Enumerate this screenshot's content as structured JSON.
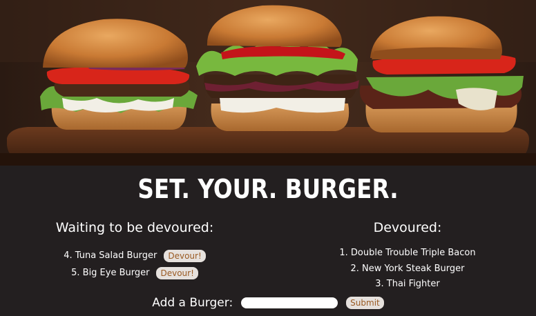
{
  "page": {
    "title": "SET. YOUR. BURGER."
  },
  "hero": {
    "icon": "burger-photo"
  },
  "waiting": {
    "heading": "Waiting to be devoured:",
    "items": [
      {
        "label": "4. Tuna Salad Burger",
        "button": "Devour!"
      },
      {
        "label": "5. Big Eye Burger",
        "button": "Devour!"
      }
    ]
  },
  "devoured": {
    "heading": "Devoured:",
    "items": [
      "1. Double Trouble Triple Bacon",
      "2. New York Steak Burger",
      "3. Thai Fighter"
    ]
  },
  "add_form": {
    "label": "Add a Burger:",
    "input_value": "",
    "input_placeholder": "",
    "submit_label": "Submit"
  },
  "colors": {
    "background": "#231f20",
    "button_bg": "#e6e1dd",
    "button_text": "#9a5a22"
  }
}
